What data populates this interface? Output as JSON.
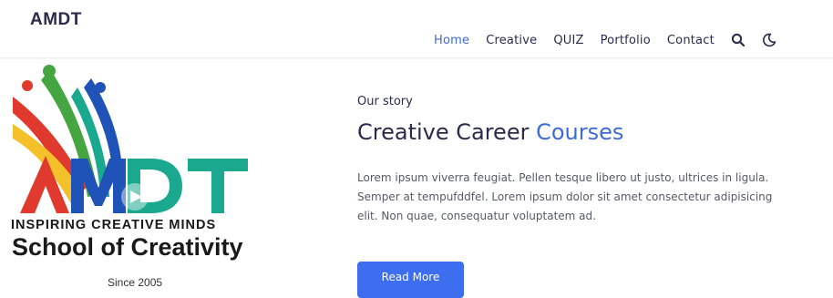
{
  "header": {
    "brand": "AMDT",
    "nav": [
      {
        "label": "Home",
        "active": true
      },
      {
        "label": "Creative"
      },
      {
        "label": "QUIZ"
      },
      {
        "label": "Portfolio"
      },
      {
        "label": "Contact"
      }
    ],
    "icons": [
      "search-icon",
      "moon-icon"
    ]
  },
  "logo": {
    "wordmark": "AMDT",
    "tagline": "INSPIRING CREATIVE MINDS",
    "school": "School of Creativity",
    "since": "Since 2005"
  },
  "story": {
    "eyebrow": "Our story",
    "headline_main": "Creative Career",
    "headline_accent": "Courses",
    "body": "Lorem ipsum viverra feugiat. Pellen tesque libero ut justo, ultrices in ligula. Semper at tempufddfel. Lorem ipsum dolor sit amet consectetur adipisicing elit. Non quae, consequatur voluptatem ad.",
    "cta": "Read More"
  },
  "colors": {
    "accent": "#3d6ad6",
    "button": "#3d6ef0",
    "text": "#2b2a4c",
    "logo_red": "#e03a2f",
    "logo_teal": "#1aa88f",
    "logo_blue": "#1f53b8",
    "logo_yellow": "#f5c12a",
    "logo_green": "#45a540"
  }
}
